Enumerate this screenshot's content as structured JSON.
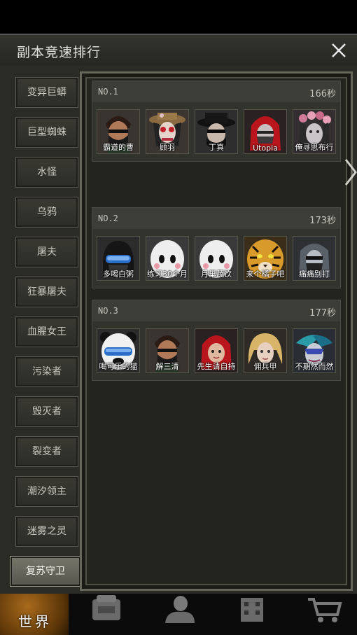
{
  "window": {
    "title": "副本竞速排行",
    "close_icon": "close-icon"
  },
  "sidebar": {
    "items": [
      {
        "label": "变异巨蟒",
        "active": false
      },
      {
        "label": "巨型蜘蛛",
        "active": false
      },
      {
        "label": "水怪",
        "active": false
      },
      {
        "label": "乌鸦",
        "active": false
      },
      {
        "label": "屠夫",
        "active": false
      },
      {
        "label": "狂暴屠夫",
        "active": false
      },
      {
        "label": "血腥女王",
        "active": false
      },
      {
        "label": "污染者",
        "active": false
      },
      {
        "label": "毁灭者",
        "active": false
      },
      {
        "label": "裂变者",
        "active": false
      },
      {
        "label": "潮汐领主",
        "active": false
      },
      {
        "label": "迷雾之灵",
        "active": false
      },
      {
        "label": "复苏守卫",
        "active": true
      }
    ]
  },
  "rankings": [
    {
      "rank": "NO.1",
      "time": "166秒",
      "players": [
        {
          "name": "霸道的曹",
          "avatar": "bearded-man-mask-avatar"
        },
        {
          "name": "顾羽",
          "avatar": "hat-girl-goggles-avatar"
        },
        {
          "name": "丁真",
          "avatar": "black-hat-man-avatar"
        },
        {
          "name": "Utopia",
          "avatar": "red-hood-avatar"
        },
        {
          "name": "俺寻思布行",
          "avatar": "flower-crown-woman-avatar"
        }
      ]
    },
    {
      "rank": "NO.2",
      "time": "173秒",
      "players": [
        {
          "name": "多喝白粥",
          "avatar": "black-helmet-goggles-avatar"
        },
        {
          "name": "练习30个月",
          "avatar": "white-mask-blush-avatar"
        },
        {
          "name": "月巢蔬饮",
          "avatar": "white-mask-blush-avatar"
        },
        {
          "name": "来个橘子吧",
          "avatar": "tiger-avatar"
        },
        {
          "name": "痛痛别打",
          "avatar": "grey-hair-mask-avatar"
        }
      ]
    },
    {
      "rank": "NO.3",
      "time": "177秒",
      "players": [
        {
          "name": "喝可乐的猫",
          "avatar": "panda-helmet-avatar"
        },
        {
          "name": "解三清",
          "avatar": "bearded-man-mask-avatar"
        },
        {
          "name": "先生请自持",
          "avatar": "red-hood-avatar"
        },
        {
          "name": "佣兵甲",
          "avatar": "blonde-woman-avatar"
        },
        {
          "name": "不期然而然",
          "avatar": "feather-mask-avatar"
        }
      ]
    }
  ],
  "bottom_nav": {
    "world_label": "世界",
    "items": [
      "world-icon",
      "backpack-icon",
      "character-icon",
      "building-icon",
      "shop-cart-icon"
    ]
  },
  "colors": {
    "panel_bg": "#2b2b26",
    "active_tab": "#66665c",
    "world_accent": "#a86a1c"
  }
}
